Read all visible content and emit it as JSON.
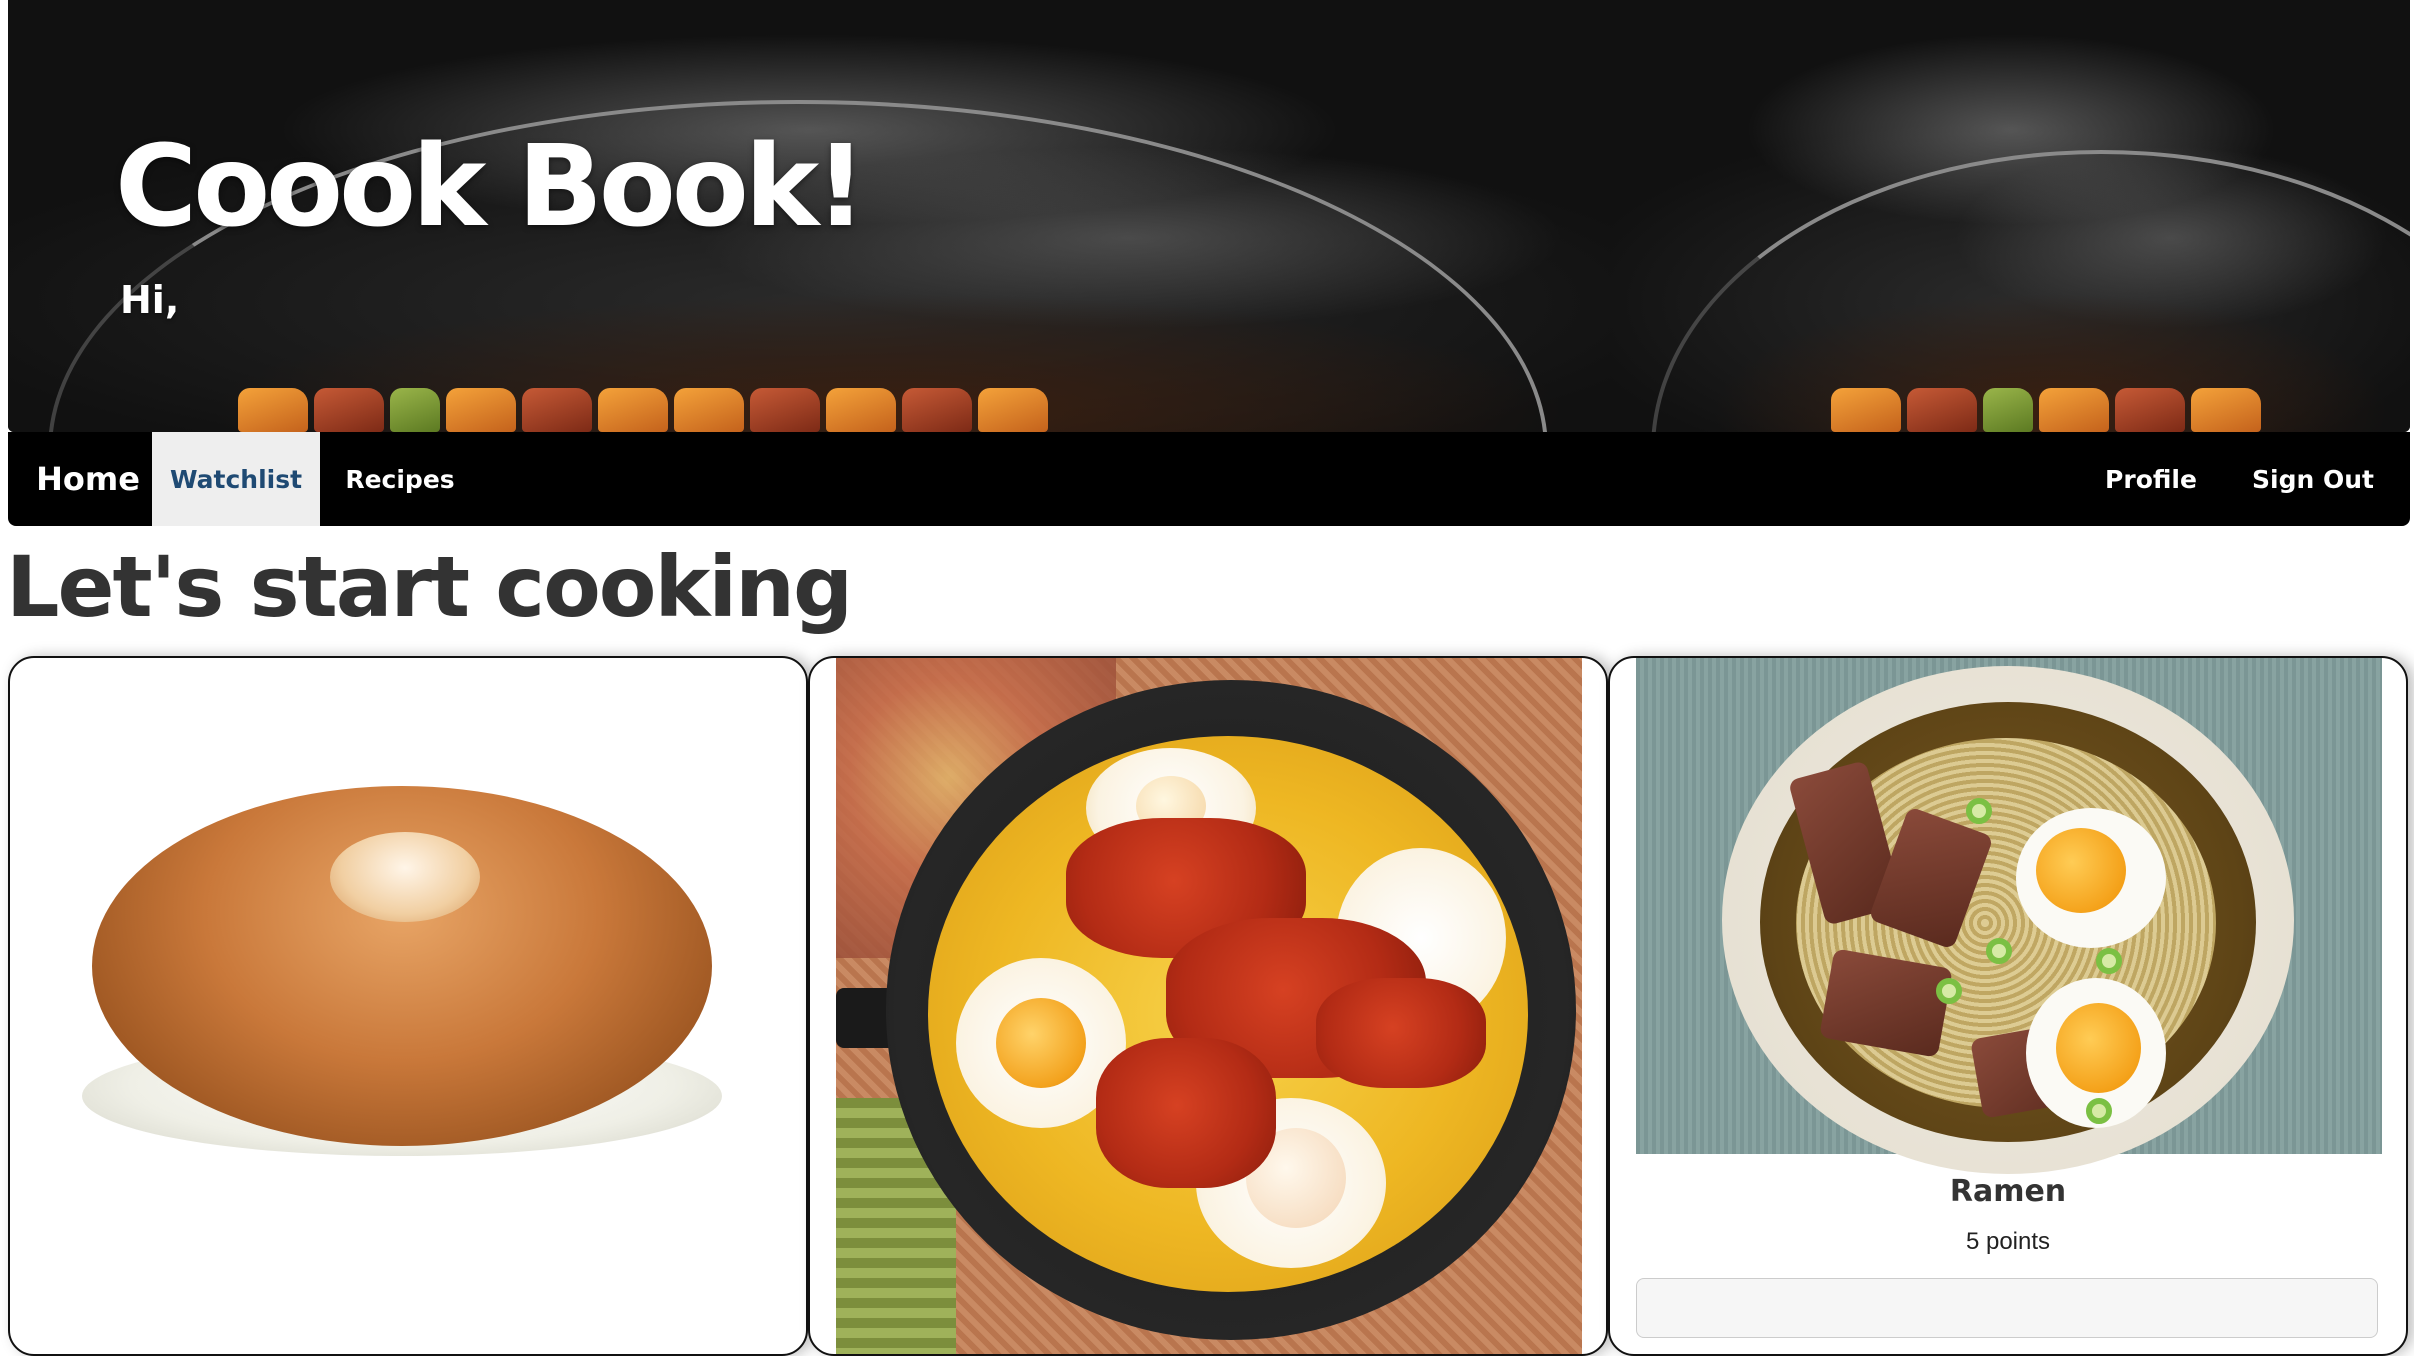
{
  "hero": {
    "title": "Coook Book!",
    "greeting": "Hi,"
  },
  "nav": {
    "home": "Home",
    "watchlist": "Watchlist",
    "recipes": "Recipes",
    "profile": "Profile",
    "sign_out": "Sign Out",
    "active": "Watchlist"
  },
  "main": {
    "heading": "Let's start cooking"
  },
  "cards": [
    {
      "image": "bagel-cream-cheese"
    },
    {
      "image": "shakshuka-pan"
    },
    {
      "image": "ramen-bowl",
      "title": "Ramen",
      "points": "5 points"
    }
  ],
  "colors": {
    "nav_bg": "#000000",
    "nav_active_bg": "#eeeeee",
    "nav_active_text": "#1f4a73",
    "heading": "#333333"
  }
}
